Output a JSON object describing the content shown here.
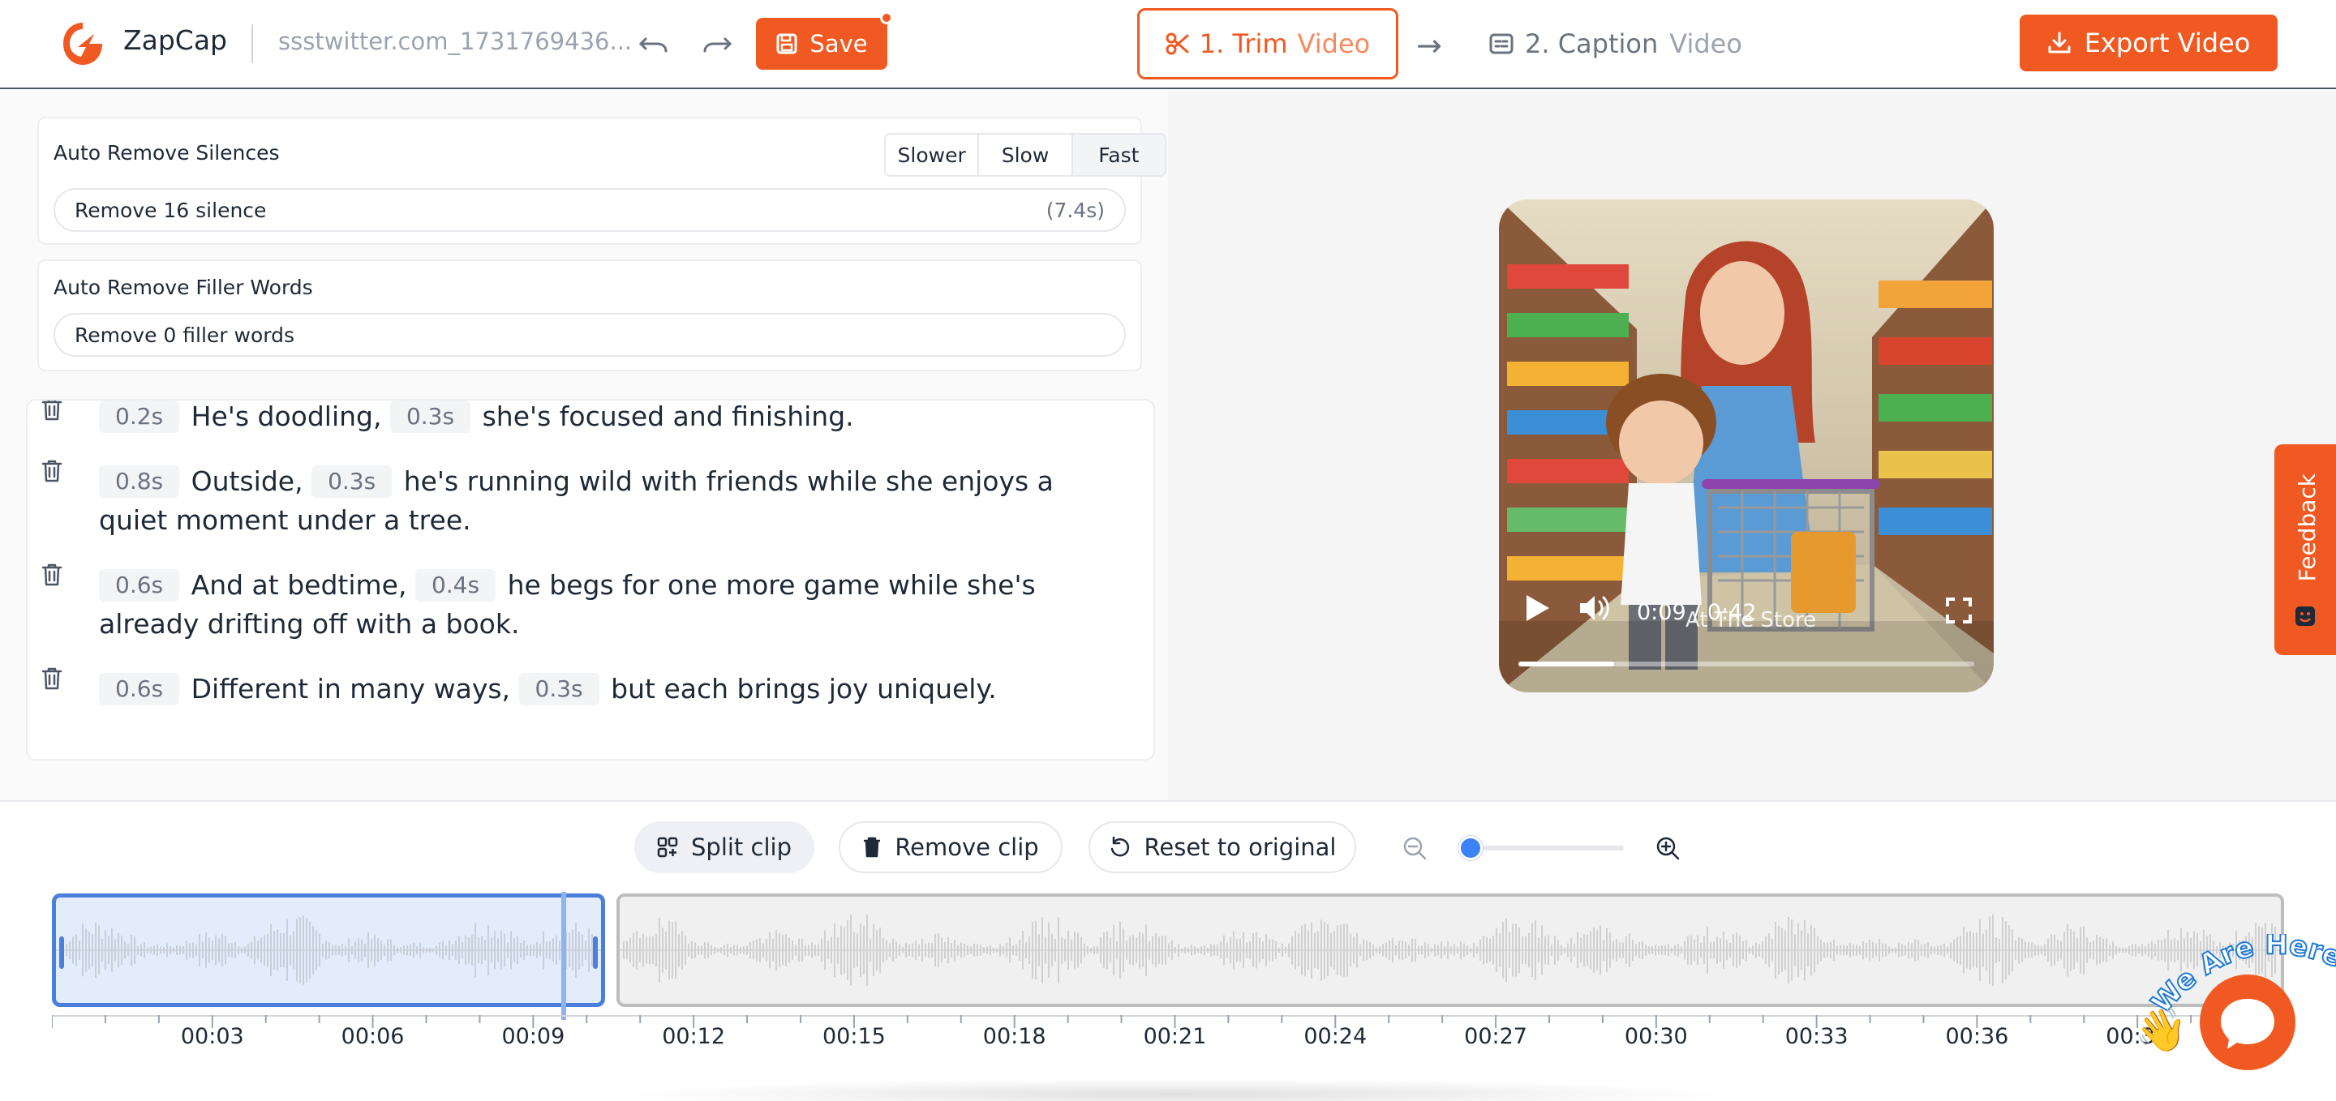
{
  "header": {
    "brand": "ZapCap",
    "filename": "ssstwitter.com_1731769436...",
    "save_label": "Save",
    "step1_num": "1. Trim",
    "step1_word": "Video",
    "step2_num": "2. Caption",
    "step2_word": "Video",
    "arrow": "→",
    "export_label": "Export Video",
    "accent_color": "#f05a22"
  },
  "silences": {
    "title": "Auto Remove Silences",
    "speeds": [
      "Slower",
      "Slow",
      "Fast"
    ],
    "selected_speed": "Fast",
    "action": "Remove 16 silence",
    "duration": "(7.4s)"
  },
  "fillers": {
    "title": "Auto Remove Filler Words",
    "action": "Remove 0 filler words"
  },
  "transcript": [
    {
      "segments": [
        {
          "gap": "0.2s",
          "text": "He's doodling,"
        },
        {
          "gap": "0.3s",
          "text": "she's focused and finishing."
        }
      ]
    },
    {
      "segments": [
        {
          "gap": "0.8s",
          "text": "Outside,"
        },
        {
          "gap": "0.3s",
          "text": "he's running wild with friends while she enjoys a quiet moment under a tree."
        }
      ]
    },
    {
      "segments": [
        {
          "gap": "0.6s",
          "text": "And at bedtime,"
        },
        {
          "gap": "0.4s",
          "text": "he begs for one more game while she's already drifting off with a book."
        }
      ]
    },
    {
      "segments": [
        {
          "gap": "0.6s",
          "text": "Different in many ways,"
        },
        {
          "gap": "0.3s",
          "text": "but each brings joy uniquely."
        }
      ]
    }
  ],
  "video": {
    "time": "0:09 / 0:42",
    "caption": "At The Store",
    "progress": 0.21
  },
  "feedback_label": "Feedback",
  "timeline": {
    "split_label": "Split clip",
    "remove_label": "Remove clip",
    "reset_label": "Reset to original",
    "zoom_level": 0,
    "ticks": [
      "00:03",
      "00:06",
      "00:09",
      "00:12",
      "00:15",
      "00:18",
      "00:21",
      "00:24",
      "00:27",
      "00:30",
      "00:33",
      "00:36",
      "00:39"
    ],
    "duration_seconds": 42,
    "selected_clip_end_seconds": 10.4,
    "playhead_seconds": 9.7
  },
  "chat": {
    "bubble_text": "We Are Here!",
    "hand": "👋"
  }
}
